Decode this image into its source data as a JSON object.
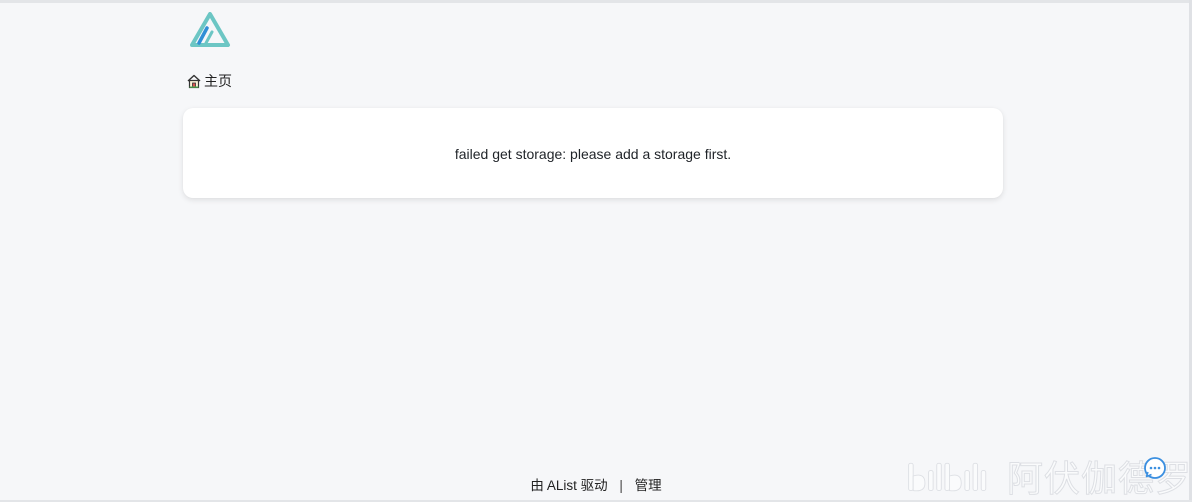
{
  "header": {
    "logo_icon": "alist-logo-icon",
    "home_icon": "home-icon",
    "home_label": "主页"
  },
  "main": {
    "message": "failed get storage: please add a storage first."
  },
  "footer": {
    "powered_prefix": "由",
    "powered_name": "AList",
    "powered_suffix": "驱动",
    "separator": "|",
    "manage_label": "管理"
  },
  "watermark": {
    "text": "阿伏伽德罗"
  },
  "floating": {
    "icon": "chat-bubble-icon"
  },
  "colors": {
    "background": "#f6f7f9",
    "card": "#ffffff",
    "logo_primary": "#6cc6c4",
    "logo_accent": "#2f8fd6",
    "float_button": "#3b8fe0"
  }
}
